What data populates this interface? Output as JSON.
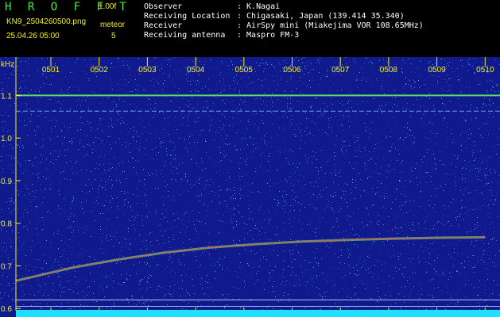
{
  "header": {
    "app_name": "H R O F F T",
    "version": "1.00f",
    "filename": "KN9_2504260500.png",
    "meteor_label": "meteor",
    "meteor_count": "5",
    "datetime": "25.04.26 05:00"
  },
  "station": {
    "observer_label": "Observer",
    "observer_value": ": K.Nagai",
    "location_label": "Receiving Location",
    "location_value": ": Chigasaki, Japan (139.414 35.340)",
    "receiver_label": "Receiver",
    "receiver_value": ": AirSpy mini (Miakejima VOR 108.65MHz)",
    "antenna_label": "Receiving antenna",
    "antenna_value": ": Maspro FM-3"
  },
  "colors": {
    "background": "#101a8c",
    "tick_yellow": "#f0f020",
    "trace_red": "#ff4a5a",
    "trace_green": "#60f060",
    "noise_cyan": "#50c8f0",
    "baseline_cyan": "#20e0ff"
  },
  "chart_data": {
    "type": "heatmap",
    "title": "",
    "ylabel": "kHz",
    "xlabel": "",
    "x_ticks": [
      "0501",
      "0502",
      "0503",
      "0504",
      "0505",
      "0506",
      "0507",
      "0508",
      "0509",
      "0510"
    ],
    "x_range_minutes": [
      0,
      10
    ],
    "y_ticks": [
      "1.1",
      "1.0",
      "0.9",
      "0.8",
      "0.7",
      "0.6"
    ],
    "y_range_khz": [
      0.58,
      1.19
    ],
    "horizontal_lines_khz": [
      1.1,
      1.063,
      0.62,
      0.605
    ],
    "drifting_carrier": {
      "name": "",
      "minutes": [
        0,
        1,
        2,
        3,
        4,
        5,
        6,
        7,
        8,
        9,
        10
      ],
      "khz": [
        0.665,
        0.696,
        0.715,
        0.731,
        0.743,
        0.751,
        0.757,
        0.761,
        0.764,
        0.766,
        0.767
      ]
    }
  }
}
